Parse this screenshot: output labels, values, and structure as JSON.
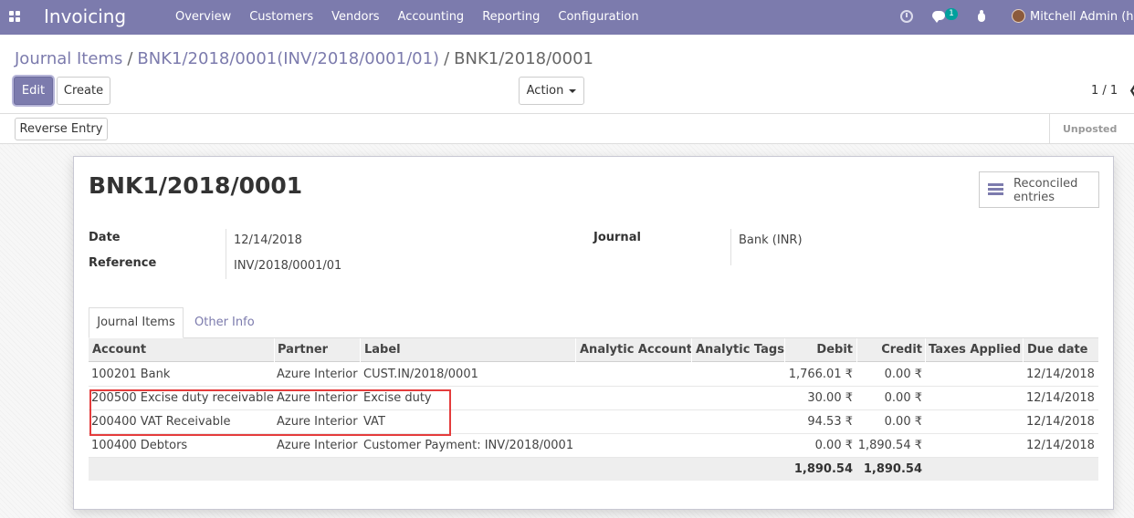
{
  "navbar": {
    "app_name": "Invoicing",
    "menu": [
      "Overview",
      "Customers",
      "Vendors",
      "Accounting",
      "Reporting",
      "Configuration"
    ],
    "chat_count": "1",
    "user": "Mitchell Admin (hah"
  },
  "breadcrumb": {
    "level1": "Journal Items",
    "level2": "BNK1/2018/0001(INV/2018/0001/01)",
    "current": "BNK1/2018/0001",
    "sep": "/"
  },
  "buttons": {
    "edit": "Edit",
    "create": "Create",
    "action": "Action",
    "reverse_entry": "Reverse Entry"
  },
  "pager": {
    "value": "1 / 1"
  },
  "status": {
    "stage": "Unposted"
  },
  "record": {
    "title": "BNK1/2018/0001",
    "smart_button": "Reconciled entries",
    "fields": {
      "date_label": "Date",
      "date_value": "12/14/2018",
      "reference_label": "Reference",
      "reference_value": "INV/2018/0001/01",
      "journal_label": "Journal",
      "journal_value": "Bank (INR)"
    }
  },
  "tabs": [
    "Journal Items",
    "Other Info"
  ],
  "table": {
    "columns": [
      "Account",
      "Partner",
      "Label",
      "Analytic Account",
      "Analytic Tags",
      "Debit",
      "Credit",
      "Taxes Applied",
      "Due date"
    ],
    "rows": [
      {
        "account": "100201 Bank",
        "partner": "Azure Interior",
        "label": "CUST.IN/2018/0001",
        "debit": "1,766.01 ₹",
        "credit": "0.00 ₹",
        "due": "12/14/2018"
      },
      {
        "account": "200500 Excise duty receivable",
        "partner": "Azure Interior",
        "label": "Excise duty",
        "debit": "30.00 ₹",
        "credit": "0.00 ₹",
        "due": "12/14/2018"
      },
      {
        "account": "200400 VAT Receivable",
        "partner": "Azure Interior",
        "label": "VAT",
        "debit": "94.53 ₹",
        "credit": "0.00 ₹",
        "due": "12/14/2018"
      },
      {
        "account": "100400 Debtors",
        "partner": "Azure Interior",
        "label": "Customer Payment: INV/2018/0001",
        "debit": "0.00 ₹",
        "credit": "1,890.54 ₹",
        "due": "12/14/2018"
      }
    ],
    "totals": {
      "debit": "1,890.54",
      "credit": "1,890.54"
    }
  },
  "colors": {
    "brand": "#7c7bad",
    "highlight": "#e43c3c"
  }
}
